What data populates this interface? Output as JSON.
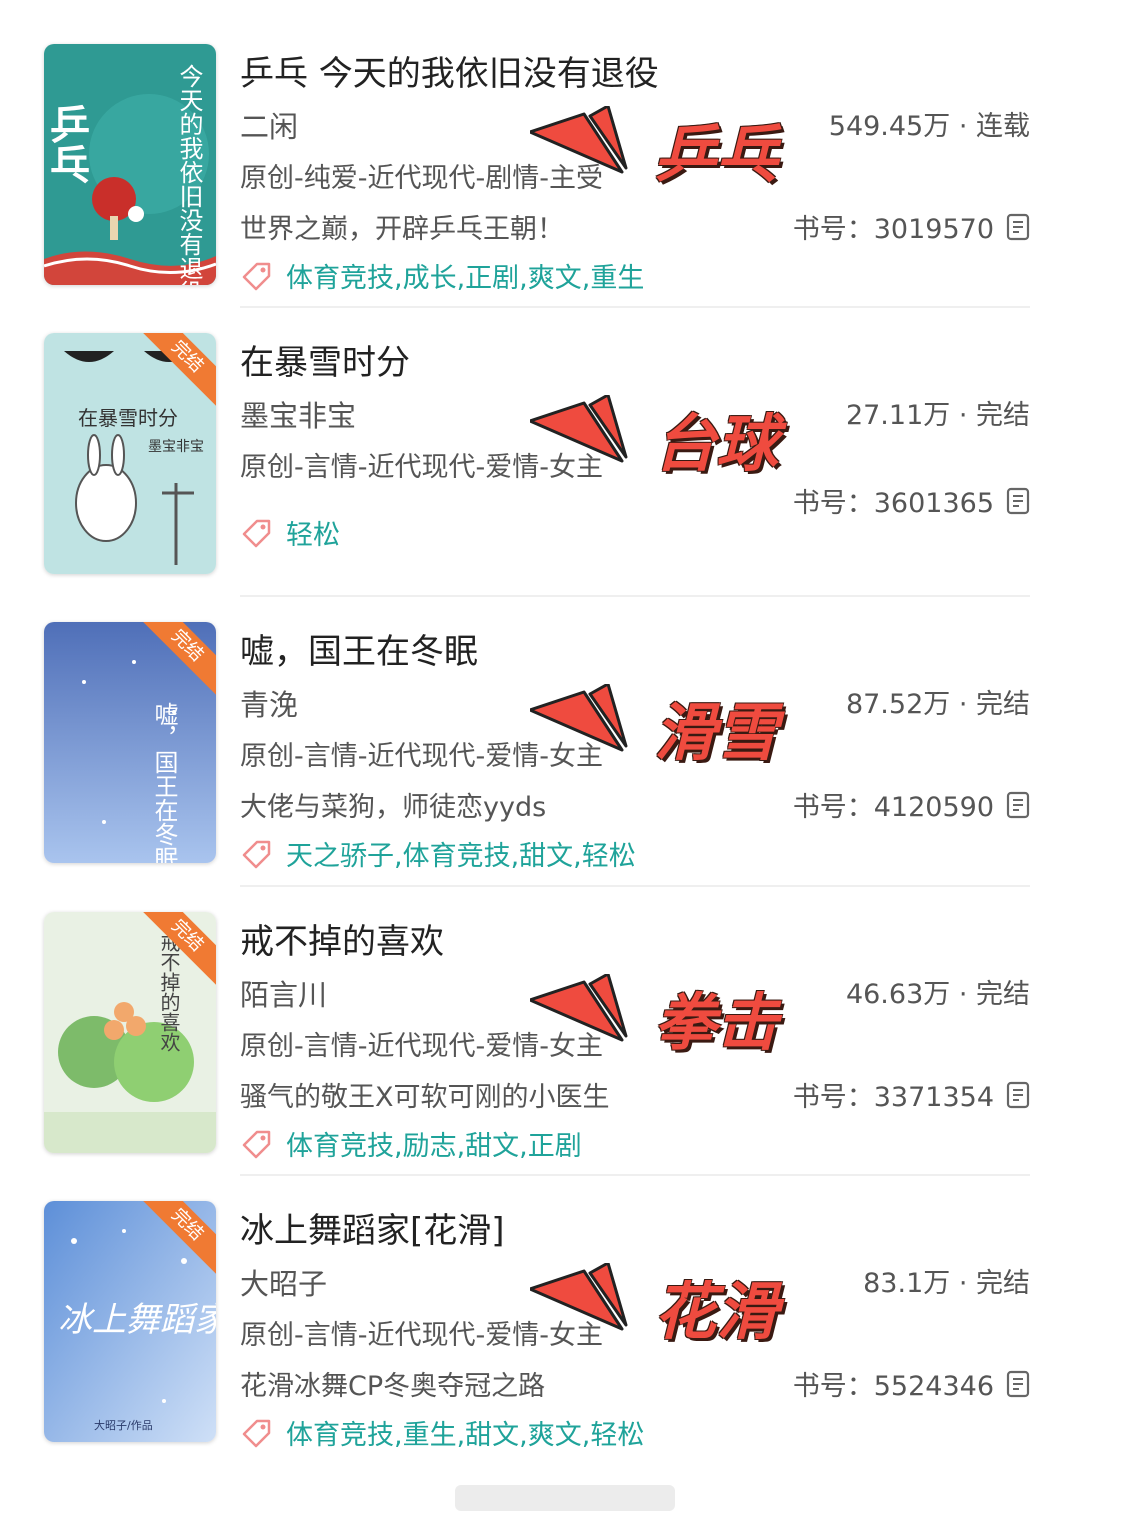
{
  "books": [
    {
      "title": "乒乓 今天的我依旧没有退役",
      "author": "二闲",
      "genre": "原创-纯爱-近代现代-剧情-主受",
      "description": "世界之巅，开辟乒乓王朝！",
      "stats": "549.45万 · 连载",
      "book_number": "书号：3019570",
      "tags": "体育竞技,成长,正剧,爽文,重生",
      "sport_label": "乒乓",
      "badge": "",
      "cover_text": "乒乓",
      "cover_subtitle": "今天的我依旧没有退役",
      "cover_color": "#2f9a93"
    },
    {
      "title": "在暴雪时分",
      "author": "墨宝非宝",
      "genre": "原创-言情-近代现代-爱情-女主",
      "description": "",
      "stats": "27.11万 · 完结",
      "book_number": "书号：3601365",
      "tags": "轻松",
      "sport_label": "台球",
      "badge": "完结",
      "cover_text": "在暴雪时分",
      "cover_subtitle": "墨宝非宝",
      "cover_color": "#bfe3e3"
    },
    {
      "title": "嘘，国王在冬眠",
      "author": "青浼",
      "genre": "原创-言情-近代现代-爱情-女主",
      "description": "大佬与菜狗，师徒恋yyds",
      "stats": "87.52万 · 完结",
      "book_number": "书号：4120590",
      "tags": "天之骄子,体育竞技,甜文,轻松",
      "sport_label": "滑雪",
      "badge": "完结",
      "cover_text": "嘘，国王在冬眠",
      "cover_subtitle": "",
      "cover_color": "#6f8fcf"
    },
    {
      "title": "戒不掉的喜欢",
      "author": "陌言川",
      "genre": "原创-言情-近代现代-爱情-女主",
      "description": "骚气的敬王X可软可刚的小医生",
      "stats": "46.63万 · 完结",
      "book_number": "书号：3371354",
      "tags": "体育竞技,励志,甜文,正剧",
      "sport_label": "拳击",
      "badge": "完结",
      "cover_text": "戒不掉的喜欢",
      "cover_subtitle": "",
      "cover_color": "#e9f1e4"
    },
    {
      "title": "冰上舞蹈家[花滑]",
      "author": "大昭子",
      "genre": "原创-言情-近代现代-爱情-女主",
      "description": "花滑冰舞CP冬奥夺冠之路",
      "stats": "83.1万 · 完结",
      "book_number": "书号：5524346",
      "tags": "体育竞技,重生,甜文,爽文,轻松",
      "sport_label": "花滑",
      "badge": "完结",
      "cover_text": "冰上舞蹈家",
      "cover_subtitle": "大昭子/作品",
      "cover_color": "#8db6ea"
    }
  ],
  "colors": {
    "tag": "#1fa39a",
    "sport_label": "#ef4b3f",
    "badge": "#f07a33"
  }
}
